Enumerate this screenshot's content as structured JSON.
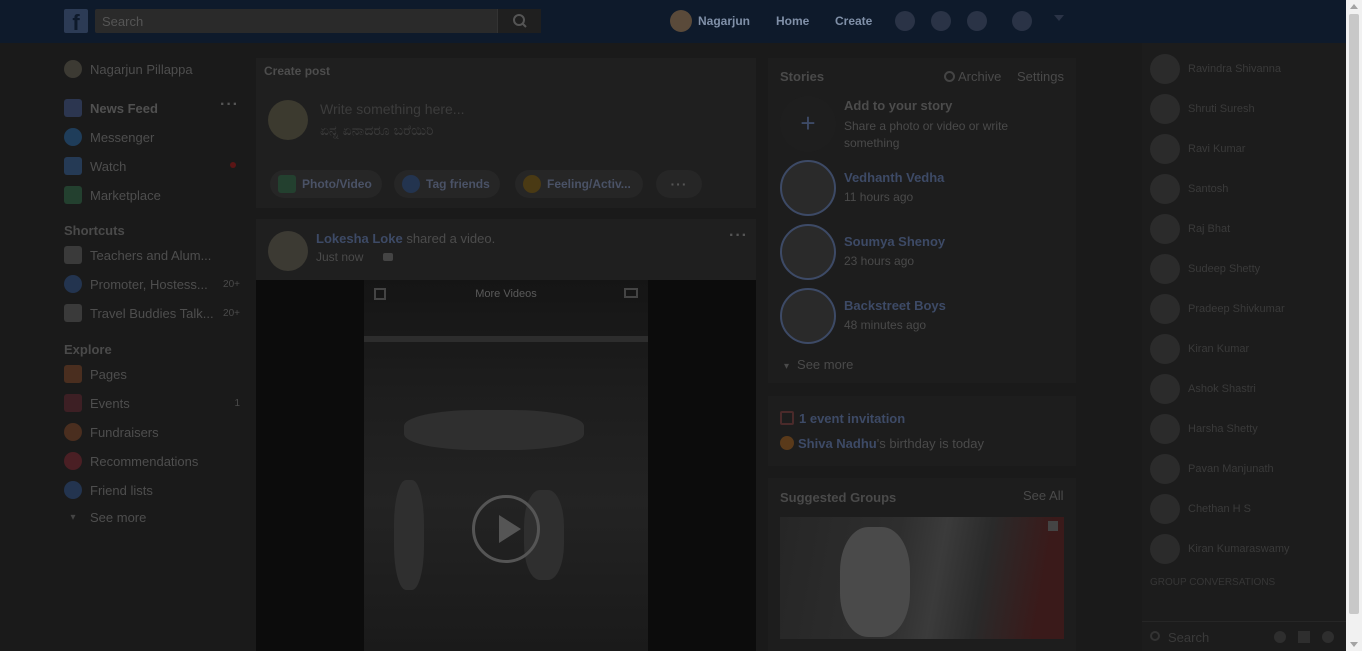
{
  "topbar": {
    "logo": "f",
    "search_placeholder": "Search",
    "user_name": "Nagarjun",
    "home": "Home",
    "create": "Create"
  },
  "leftnav": {
    "profile": "Nagarjun Pillappa",
    "items": [
      {
        "label": "News Feed"
      },
      {
        "label": "Messenger"
      },
      {
        "label": "Watch"
      },
      {
        "label": "Marketplace"
      }
    ],
    "shortcuts_title": "Shortcuts",
    "shortcuts": [
      {
        "label": "Teachers and Alum...",
        "count": ""
      },
      {
        "label": "Promoter, Hostess...",
        "count": "20+"
      },
      {
        "label": "Travel Buddies Talk...",
        "count": "20+"
      }
    ],
    "explore_title": "Explore",
    "explore": [
      {
        "label": "Pages",
        "count": ""
      },
      {
        "label": "Events",
        "count": "1"
      },
      {
        "label": "Fundraisers",
        "count": ""
      },
      {
        "label": "Recommendations",
        "count": ""
      },
      {
        "label": "Friend lists",
        "count": ""
      }
    ],
    "see_more": "See more"
  },
  "composer": {
    "title": "Create post",
    "placeholder_line1": "Write something here...",
    "placeholder_line2": "ಏನ್ನ ಏನಾದರೂ ಬರೆಯಿರಿ",
    "photo_video": "Photo/Video",
    "tag_friends": "Tag friends",
    "feeling": "Feeling/Activ..."
  },
  "post": {
    "author": "Lokesha Loke",
    "action": " shared a video.",
    "time": "Just now",
    "video_label": "More Videos"
  },
  "stories": {
    "title": "Stories",
    "archive": "Archive",
    "settings": "Settings",
    "add_title": "Add to your story",
    "add_subtitle": "Share a photo or video or write something",
    "items": [
      {
        "name": "Vedhanth Vedha",
        "time": "11 hours ago"
      },
      {
        "name": "Soumya Shenoy",
        "time": "23 hours ago"
      },
      {
        "name": "Backstreet Boys",
        "time": "48 minutes ago"
      }
    ],
    "see_more": "See more"
  },
  "events": {
    "invitation": "1 event invitation",
    "birthday_name": "Shiva Nadhu",
    "birthday_text": "'s birthday is today"
  },
  "groups": {
    "title": "Suggested Groups",
    "see_all": "See All"
  },
  "chat": {
    "contacts": [
      "Ravindra Shivanna",
      "Shruti Suresh",
      "Ravi Kumar",
      "Santosh",
      "Raj Bhat",
      "Sudeep Shetty",
      "Pradeep Shivkumar",
      "Kiran Kumar",
      "Ashok Shastri",
      "Harsha Shetty",
      "Pavan Manjunath",
      "Chethan H S",
      "Kiran Kumaraswamy"
    ],
    "group_title": "GROUP CONVERSATIONS",
    "search_placeholder": "Search"
  },
  "colors": {
    "topbar": "#0e1a2b",
    "accent": "#3d4a66"
  }
}
